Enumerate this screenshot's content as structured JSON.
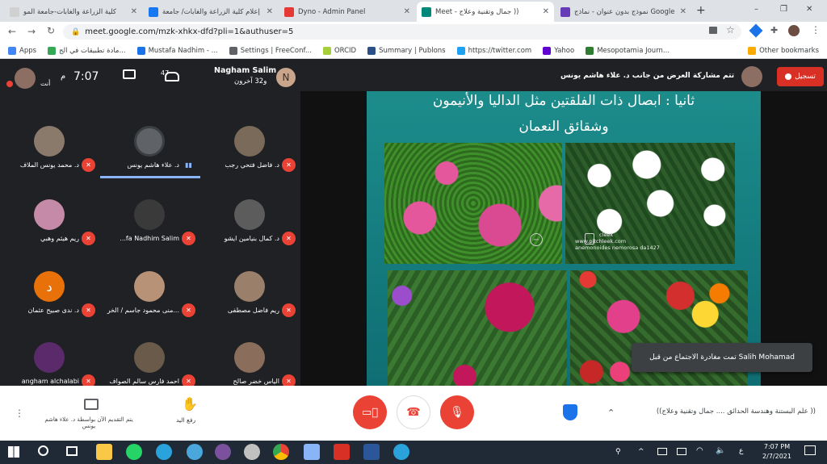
{
  "tabs": [
    {
      "title": "كلية الزراعة والغابات-جامعة المو",
      "active": false,
      "color": "#d0d0d0"
    },
    {
      "title": "إعلام كلية الزراعة والغابات/ جامعة",
      "active": false,
      "color": "#1877f2"
    },
    {
      "title": "Dyno - Admin Panel",
      "active": false,
      "color": "#e53935"
    },
    {
      "title": "Meet - جمال وتقنية وعلاج ))",
      "active": true,
      "color": "#00897b"
    },
    {
      "title": "نموذج بدون عنوان - نماذج Google",
      "active": false,
      "color": "#673ab7"
    }
  ],
  "new_tab": "+",
  "window_controls": {
    "minimize": "–",
    "restore": "❐",
    "close": "✕"
  },
  "url": "meet.google.com/mzk-xhkx-dfd?pli=1&authuser=5",
  "bookmarks": [
    {
      "label": "Apps",
      "color": "#4285f4"
    },
    {
      "label": "مادة تطبيقات في الج...",
      "color": "#34a853"
    },
    {
      "label": "Mustafa Nadhim - ...",
      "color": "#1a73e8"
    },
    {
      "label": "Settings | FreeConf...",
      "color": "#5f6368"
    },
    {
      "label": "ORCID",
      "color": "#a6ce39"
    },
    {
      "label": "Summary | Publons",
      "color": "#2b4f87"
    },
    {
      "label": "https://twitter.com",
      "color": "#1da1f2"
    },
    {
      "label": "Yahoo",
      "color": "#6001d2"
    },
    {
      "label": "Mesopotamia Journ...",
      "color": "#2e7d32"
    }
  ],
  "other_bookmarks": "Other bookmarks",
  "meet": {
    "self_label": "أنت",
    "time": "7:07",
    "ampm": "م",
    "people_count": "47",
    "host_name": "Nagham Salim",
    "host_sub": "و32 آخرون",
    "host_initial": "N",
    "presenter_text": "تتم مشاركة العرض من جانب د. علاء هاشم يونس",
    "record_label": "تسجيل"
  },
  "participants": [
    {
      "name": "د. فاضل فتحي رجب",
      "initial": "",
      "muted": true
    },
    {
      "name": "د. علاء هاشم يونس",
      "initial": "",
      "muted": false,
      "speaking": true
    },
    {
      "name": "د. محمد يونس الملاف",
      "initial": "",
      "muted": true
    },
    {
      "name": "د. كمال بنيامين ايشو",
      "initial": "",
      "muted": true
    },
    {
      "name": "...fa Nadhim Salim",
      "initial": "",
      "muted": true
    },
    {
      "name": "ريم هيثم وهبي",
      "initial": "",
      "muted": true
    },
    {
      "name": "ريم فاضل مصطفى",
      "initial": "",
      "muted": true
    },
    {
      "name": "منى محمود جاسم / الخر...",
      "initial": "",
      "muted": true
    },
    {
      "name": "د. ندى صبيح عثمان",
      "initial": "د",
      "muted": true
    },
    {
      "name": "الياس خضر صالح",
      "initial": "",
      "muted": true
    },
    {
      "name": "احمد فارس سالم الصواف",
      "initial": "",
      "muted": true
    },
    {
      "name": "angham alchalabi",
      "initial": "",
      "muted": true
    }
  ],
  "slide": {
    "title_line1": "ثانيا : ابصال ذات الفلقتين مثل الداليا والأنيمون",
    "title_line2": "وشقائق النعمان",
    "watermark_line1": "cleek",
    "watermark_line2": "www.pitchleek.com",
    "watermark_line3": "anemonoides nemorosa da1427"
  },
  "toast": "تمت مغادرة الاجتماع من قبل Salih Mohamad",
  "bottom": {
    "presenting_label": "يتم التقديم الآن بواسطة د. علاء هاشم يونس",
    "raise_hand_label": "رفع اليد",
    "meeting_title": "((علم البستنة وهندسة الحدائق .... جمال وتقنية وعلاج ))"
  },
  "taskbar": {
    "time": "7:07 PM",
    "date": "2/7/2021",
    "lang": "ع"
  }
}
